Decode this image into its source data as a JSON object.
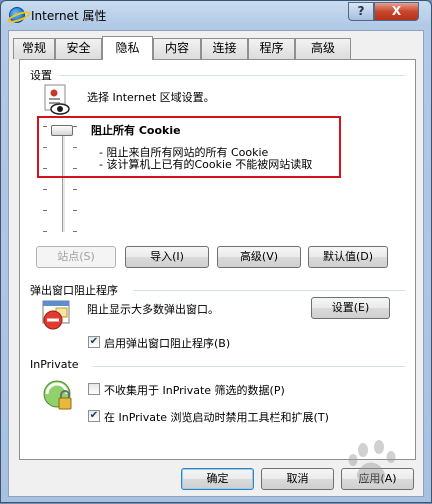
{
  "window": {
    "title": "Internet 属性",
    "help_label": "?",
    "close_label": "X"
  },
  "tabs": [
    {
      "label": "常规"
    },
    {
      "label": "安全"
    },
    {
      "label": "隐私",
      "active": true
    },
    {
      "label": "内容"
    },
    {
      "label": "连接"
    },
    {
      "label": "程序"
    },
    {
      "label": "高级"
    }
  ],
  "settings": {
    "section_label": "设置",
    "zone_text": "选择 Internet 区域设置。",
    "level_title": "阻止所有 Cookie",
    "level_desc": [
      "- 阻止来自所有网站的所有 Cookie",
      "- 该计算机上已有的Cookie 不能被网站读取"
    ],
    "slider_level": "top",
    "buttons": {
      "sites": "站点(S)",
      "import": "导入(I)",
      "advanced": "高级(V)",
      "default": "默认值(D)"
    }
  },
  "popup": {
    "section_label": "弹出窗口阻止程序",
    "desc": "阻止显示大多数弹出窗口。",
    "settings_button": "设置(E)",
    "enable_label": "启用弹出窗口阻止程序(B)",
    "enable_checked": true
  },
  "inprivate": {
    "section_label": "InPrivate",
    "no_collect_label": "不收集用于 InPrivate 筛选的数据(P)",
    "no_collect_checked": false,
    "disable_toolbars_label": "在 InPrivate 浏览启动时禁用工具栏和扩展(T)",
    "disable_toolbars_checked": true
  },
  "footer": {
    "ok": "确定",
    "cancel": "取消",
    "apply": "应用(A)"
  },
  "colors": {
    "highlight_box": "#d3121b",
    "title_bar": "#b3cae6",
    "close_button": "#c8462a"
  }
}
